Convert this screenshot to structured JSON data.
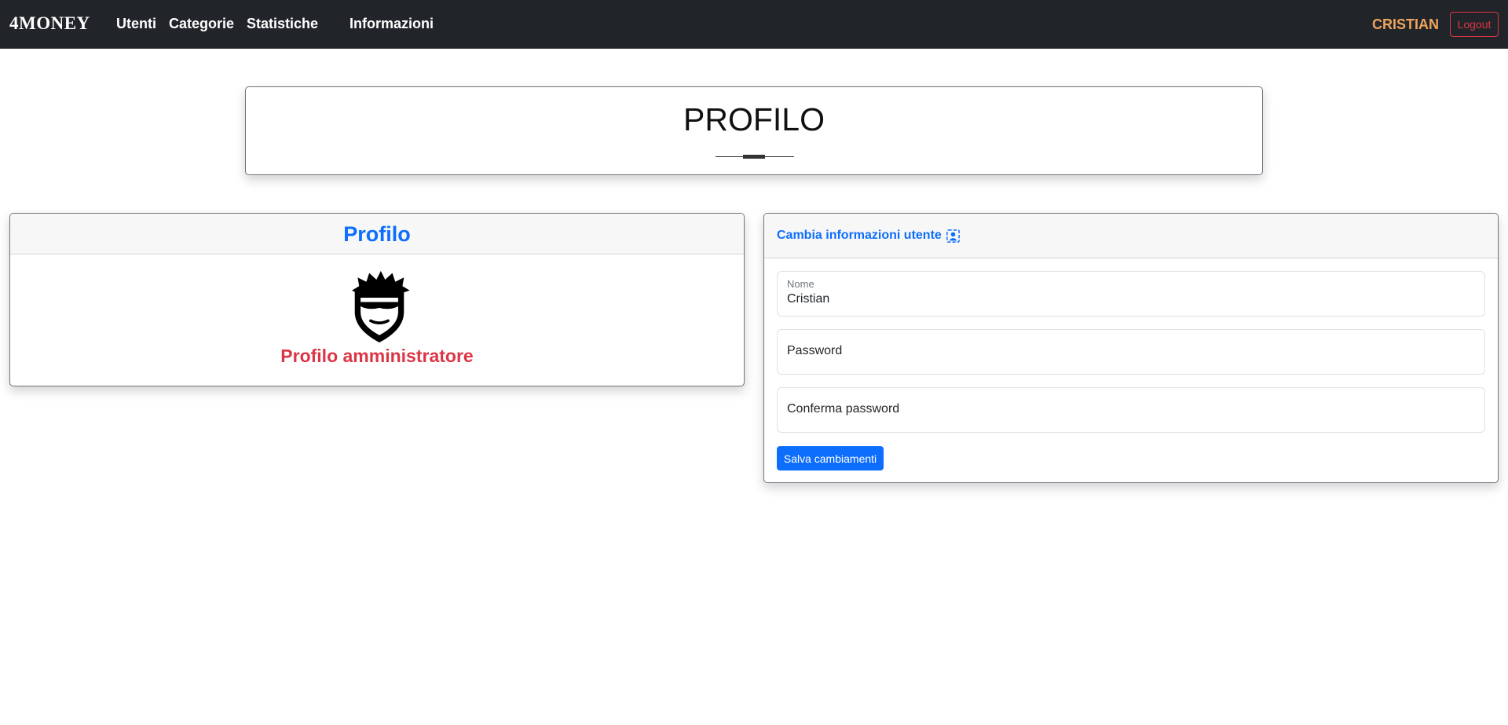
{
  "navbar": {
    "brand": "4MONEY",
    "links": [
      "Utenti",
      "Categorie",
      "Statistiche",
      "Informazioni"
    ],
    "user": "CRISTIAN",
    "logout_label": "Logout"
  },
  "page": {
    "title": "PROFILO"
  },
  "profile_card": {
    "header": "Profilo",
    "role": "Profilo amministratore"
  },
  "settings_card": {
    "title": "Cambia informazioni utente",
    "title_icon": "user-badge-icon",
    "fields": {
      "name": {
        "label": "Nome",
        "value": "Cristian"
      },
      "password": {
        "placeholder": "Password"
      },
      "confirm": {
        "placeholder": "Conferma password"
      }
    },
    "save_label": "Salva cambiamenti"
  },
  "colors": {
    "navbar_bg": "#212529",
    "accent_blue": "#0d6efd",
    "danger_red": "#dc3545",
    "user_orange": "#f0a35e"
  }
}
